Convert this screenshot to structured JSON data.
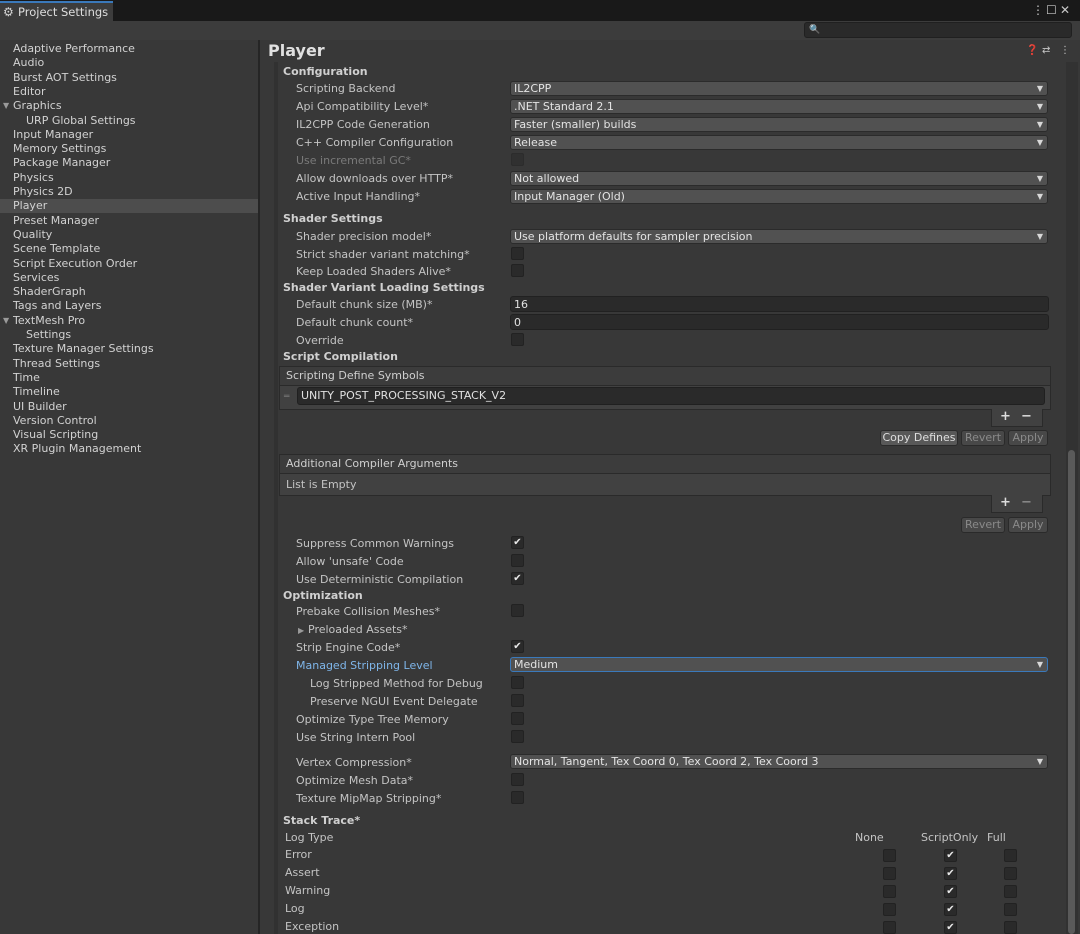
{
  "window": {
    "tab_title": "Project Settings",
    "tab_icon": "gear-icon"
  },
  "sidebar": {
    "items": [
      {
        "label": "Adaptive Performance",
        "indent": 0,
        "expandable": false,
        "selected": false
      },
      {
        "label": "Audio",
        "indent": 0,
        "expandable": false,
        "selected": false
      },
      {
        "label": "Burst AOT Settings",
        "indent": 0,
        "expandable": false,
        "selected": false
      },
      {
        "label": "Editor",
        "indent": 0,
        "expandable": false,
        "selected": false
      },
      {
        "label": "Graphics",
        "indent": 0,
        "expandable": true,
        "selected": false
      },
      {
        "label": "URP Global Settings",
        "indent": 1,
        "expandable": false,
        "selected": false
      },
      {
        "label": "Input Manager",
        "indent": 0,
        "expandable": false,
        "selected": false
      },
      {
        "label": "Memory Settings",
        "indent": 0,
        "expandable": false,
        "selected": false
      },
      {
        "label": "Package Manager",
        "indent": 0,
        "expandable": false,
        "selected": false
      },
      {
        "label": "Physics",
        "indent": 0,
        "expandable": false,
        "selected": false
      },
      {
        "label": "Physics 2D",
        "indent": 0,
        "expandable": false,
        "selected": false
      },
      {
        "label": "Player",
        "indent": 0,
        "expandable": false,
        "selected": true
      },
      {
        "label": "Preset Manager",
        "indent": 0,
        "expandable": false,
        "selected": false
      },
      {
        "label": "Quality",
        "indent": 0,
        "expandable": false,
        "selected": false
      },
      {
        "label": "Scene Template",
        "indent": 0,
        "expandable": false,
        "selected": false
      },
      {
        "label": "Script Execution Order",
        "indent": 0,
        "expandable": false,
        "selected": false
      },
      {
        "label": "Services",
        "indent": 0,
        "expandable": false,
        "selected": false
      },
      {
        "label": "ShaderGraph",
        "indent": 0,
        "expandable": false,
        "selected": false
      },
      {
        "label": "Tags and Layers",
        "indent": 0,
        "expandable": false,
        "selected": false
      },
      {
        "label": "TextMesh Pro",
        "indent": 0,
        "expandable": true,
        "selected": false
      },
      {
        "label": "Settings",
        "indent": 1,
        "expandable": false,
        "selected": false
      },
      {
        "label": "Texture Manager Settings",
        "indent": 0,
        "expandable": false,
        "selected": false
      },
      {
        "label": "Thread Settings",
        "indent": 0,
        "expandable": false,
        "selected": false
      },
      {
        "label": "Time",
        "indent": 0,
        "expandable": false,
        "selected": false
      },
      {
        "label": "Timeline",
        "indent": 0,
        "expandable": false,
        "selected": false
      },
      {
        "label": "UI Builder",
        "indent": 0,
        "expandable": false,
        "selected": false
      },
      {
        "label": "Version Control",
        "indent": 0,
        "expandable": false,
        "selected": false
      },
      {
        "label": "Visual Scripting",
        "indent": 0,
        "expandable": false,
        "selected": false
      },
      {
        "label": "XR Plugin Management",
        "indent": 0,
        "expandable": false,
        "selected": false
      }
    ]
  },
  "main": {
    "title": "Player",
    "configuration": {
      "heading": "Configuration",
      "scripting_backend": {
        "label": "Scripting Backend",
        "value": "IL2CPP"
      },
      "api_compat": {
        "label": "Api Compatibility Level*",
        "value": ".NET Standard 2.1"
      },
      "il2cpp_codegen": {
        "label": "IL2CPP Code Generation",
        "value": "Faster (smaller) builds"
      },
      "cpp_compiler": {
        "label": "C++ Compiler Configuration",
        "value": "Release"
      },
      "incremental_gc": {
        "label": "Use incremental GC*",
        "checked": false,
        "enabled": false
      },
      "allow_http": {
        "label": "Allow downloads over HTTP*",
        "value": "Not allowed"
      },
      "input_handling": {
        "label": "Active Input Handling*",
        "value": "Input Manager (Old)"
      }
    },
    "shader_settings": {
      "heading": "Shader Settings",
      "precision_model": {
        "label": "Shader precision model*",
        "value": "Use platform defaults for sampler precision"
      },
      "strict_variant": {
        "label": "Strict shader variant matching*",
        "checked": false
      },
      "keep_loaded": {
        "label": "Keep Loaded Shaders Alive*",
        "checked": false
      }
    },
    "shader_variant_loading": {
      "heading": "Shader Variant Loading Settings",
      "chunk_size": {
        "label": "Default chunk size (MB)*",
        "value": "16"
      },
      "chunk_count": {
        "label": "Default chunk count*",
        "value": "0"
      },
      "override": {
        "label": "Override",
        "checked": false
      }
    },
    "script_compilation": {
      "heading": "Script Compilation",
      "define_symbols": {
        "header": "Scripting Define Symbols",
        "items": [
          "UNITY_POST_PROCESSING_STACK_V2"
        ],
        "add": "+",
        "remove": "−",
        "copy_defines": "Copy Defines",
        "revert": "Revert",
        "apply": "Apply"
      },
      "compiler_args": {
        "header": "Additional Compiler Arguments",
        "empty_text": "List is Empty",
        "add": "+",
        "remove": "−",
        "revert": "Revert",
        "apply": "Apply"
      },
      "suppress_warnings": {
        "label": "Suppress Common Warnings",
        "checked": true
      },
      "allow_unsafe": {
        "label": "Allow 'unsafe' Code",
        "checked": false
      },
      "deterministic": {
        "label": "Use Deterministic Compilation",
        "checked": true
      }
    },
    "optimization": {
      "heading": "Optimization",
      "prebake": {
        "label": "Prebake Collision Meshes*",
        "checked": false
      },
      "preloaded_assets": {
        "label": "Preloaded Assets*"
      },
      "strip_engine": {
        "label": "Strip Engine Code*",
        "checked": true
      },
      "managed_stripping": {
        "label": "Managed Stripping Level",
        "value": "Medium"
      },
      "log_stripped": {
        "label": "Log Stripped Method for Debug",
        "checked": false
      },
      "preserve_ngui": {
        "label": "Preserve NGUI Event Delegate",
        "checked": false
      },
      "type_tree": {
        "label": "Optimize Type Tree Memory",
        "checked": false
      },
      "string_intern": {
        "label": "Use String Intern Pool",
        "checked": false
      },
      "vertex_compression": {
        "label": "Vertex Compression*",
        "value": "Normal, Tangent, Tex Coord 0, Tex Coord 2, Tex Coord 3"
      },
      "optimize_mesh": {
        "label": "Optimize Mesh Data*",
        "checked": false
      },
      "mipmap_stripping": {
        "label": "Texture MipMap Stripping*",
        "checked": false
      }
    },
    "stack_trace": {
      "heading": "Stack Trace*",
      "log_type_label": "Log Type",
      "columns": [
        "None",
        "ScriptOnly",
        "Full"
      ],
      "rows": [
        {
          "label": "Error",
          "selected": "ScriptOnly"
        },
        {
          "label": "Assert",
          "selected": "ScriptOnly"
        },
        {
          "label": "Warning",
          "selected": "ScriptOnly"
        },
        {
          "label": "Log",
          "selected": "ScriptOnly"
        },
        {
          "label": "Exception",
          "selected": "ScriptOnly"
        }
      ]
    }
  }
}
